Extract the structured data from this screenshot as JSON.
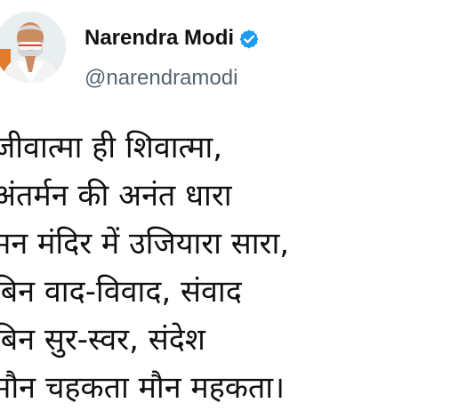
{
  "tweet": {
    "author": {
      "display_name": "Narendra Modi",
      "handle": "@narendramodi",
      "verified": true,
      "avatar_icon": "profile-photo",
      "verified_icon": "verified-badge-icon"
    },
    "text_lines": [
      "जीवात्मा ही शिवात्मा,",
      "अंतर्मन की अनंत धारा",
      "मन मंदिर में उजियारा सारा,",
      "बिन वाद-विवाद, संवाद",
      "बिन सुर-स्वर, संदेश",
      "मौन चहकता मौन महकता।"
    ]
  },
  "colors": {
    "background": "#ffffff",
    "text": "#111111",
    "handle": "#536471",
    "verified": "#1d9bf0"
  }
}
